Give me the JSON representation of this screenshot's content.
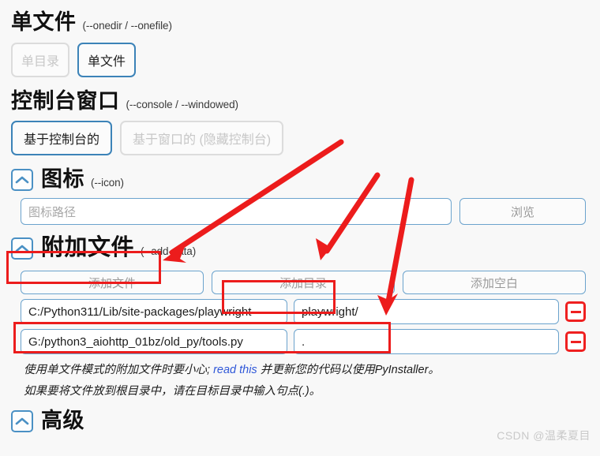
{
  "sections": {
    "onefile": {
      "title": "单文件",
      "flag": "(--onedir / --onefile)",
      "options": [
        {
          "label": "单目录",
          "selected": false
        },
        {
          "label": "单文件",
          "selected": true
        }
      ]
    },
    "console": {
      "title": "控制台窗口",
      "flag": "(--console / --windowed)",
      "options": [
        {
          "label": "基于控制台的",
          "selected": true
        },
        {
          "label": "基于窗口的 (隐藏控制台)",
          "selected": false
        }
      ]
    },
    "icon": {
      "title": "图标",
      "flag": "(--icon)",
      "collapse_icon": "chevron-up-icon",
      "path_placeholder": "图标路径",
      "path_value": "",
      "browse_label": "浏览"
    },
    "adddata": {
      "title": "附加文件",
      "flag": "(--add-data)",
      "collapse_icon": "chevron-up-icon",
      "actions": [
        {
          "label": "添加文件",
          "name": "add-file-button"
        },
        {
          "label": "添加目录",
          "name": "add-directory-button"
        },
        {
          "label": "添加空白",
          "name": "add-blank-button"
        }
      ],
      "rows": [
        {
          "source": "C:/Python311/Lib/site-packages/playwright",
          "destination": "playwright/",
          "remove_icon": "minus-icon"
        },
        {
          "source": "G:/python3_aiohttp_01bz/old_py/tools.py",
          "destination": ".",
          "remove_icon": "minus-icon"
        }
      ],
      "notes": {
        "line1_before": "使用单文件模式的附加文件时要小心; ",
        "line1_link": "read this",
        "line1_after": " 并更新您的代码以使用PyInstaller。",
        "line2": "如果要将文件放到根目录中，请在目标目录中输入句点(.)。"
      }
    },
    "advanced": {
      "title": "高级",
      "collapse_icon": "chevron-up-icon"
    }
  },
  "annotations": {
    "accent_color": "#ec1c1c",
    "boxes": [
      {
        "name": "highlight-add-data-heading"
      },
      {
        "name": "highlight-add-directory-button"
      },
      {
        "name": "highlight-first-data-row"
      }
    ],
    "arrows": [
      {
        "name": "arrow-to-add-data-heading"
      },
      {
        "name": "arrow-to-add-directory-button"
      },
      {
        "name": "arrow-to-destination-field"
      }
    ]
  },
  "watermark": "CSDN @温柔夏目"
}
